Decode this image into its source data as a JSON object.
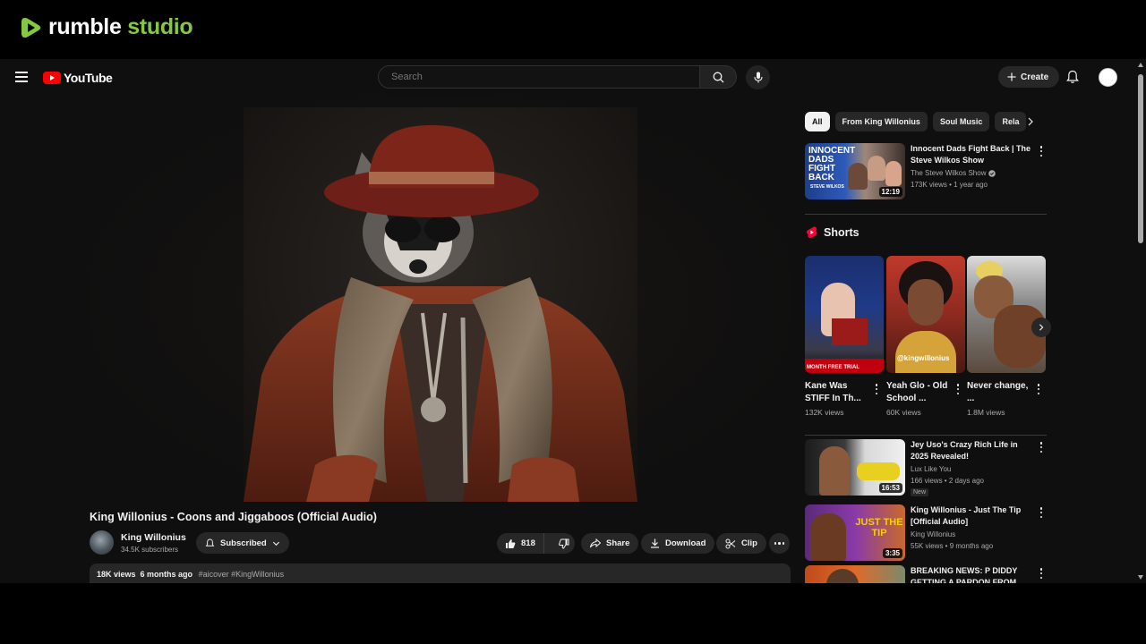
{
  "rumble": {
    "brand": "rumble",
    "studio": "studio",
    "accent": "#85c742"
  },
  "masthead": {
    "logo_text": "YouTube",
    "search_placeholder": "Search",
    "create_label": "Create"
  },
  "video": {
    "title": "King Willonius - Coons and Jiggaboos (Official Audio)",
    "channel": "King Willonius",
    "subscribers": "34.5K subscribers",
    "subscribed_label": "Subscribed",
    "likes": "818",
    "share_label": "Share",
    "download_label": "Download",
    "clip_label": "Clip",
    "views": "18K views",
    "age": "6 months ago",
    "tags": "#aicover #KingWillonius"
  },
  "chips": [
    "All",
    "From King Willonius",
    "Soul Music",
    "Rela"
  ],
  "recommendations_top": [
    {
      "title": "Innocent Dads Fight Back | The Steve Wilkos Show",
      "channel": "The Steve Wilkos Show",
      "meta": "173K views • 1 year ago",
      "duration": "12:19",
      "thumb_text": "INNOCENT DADS FIGHT BACK",
      "thumb_sub": "STEVE WILKOS"
    }
  ],
  "shorts": {
    "header": "Shorts",
    "items": [
      {
        "title": "Kane Was STIFF In Th...",
        "views": "132K views",
        "thumb_text": "MONTH FREE TRIAL"
      },
      {
        "title": "Yeah Glo - Old School ...",
        "views": "60K views",
        "thumb_text": "@kingwillonius"
      },
      {
        "title": "Never change, ...",
        "views": "1.8M views",
        "thumb_text": ""
      }
    ]
  },
  "recommendations_bottom": [
    {
      "title": "Jey Uso's Crazy Rich Life in 2025 Revealed!",
      "channel": "Lux Like You",
      "meta": "166 views • 2 days ago",
      "badge": "New",
      "duration": "16:53"
    },
    {
      "title": "King Willonius - Just The Tip [Official Audio]",
      "channel": "King Willonius",
      "meta": "55K views • 9 months ago",
      "duration": "3:35",
      "thumb_text": "JUST THE TIP"
    },
    {
      "title": "BREAKING NEWS: P DIDDY GETTING A PARDON FROM",
      "channel": "",
      "meta": ""
    }
  ]
}
